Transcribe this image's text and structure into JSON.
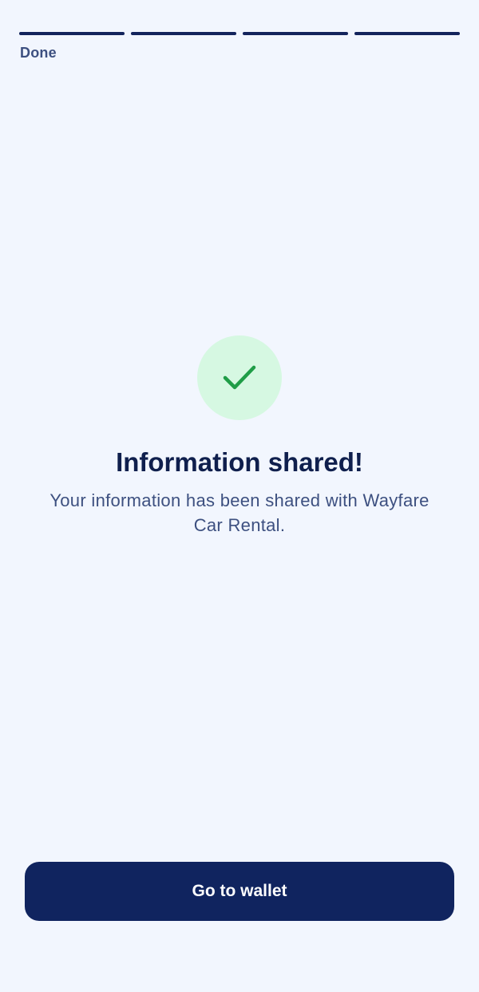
{
  "progress": {
    "total_steps": 4,
    "completed_steps": 4,
    "label": "Done"
  },
  "result": {
    "icon": "checkmark-icon",
    "icon_color": "#1f9d47",
    "icon_bg": "#d6f8e2",
    "title": "Information shared!",
    "message": "Your information has been shared with Wayfare Car Rental."
  },
  "actions": {
    "primary_label": "Go to wallet",
    "primary_color": "#10245f"
  }
}
